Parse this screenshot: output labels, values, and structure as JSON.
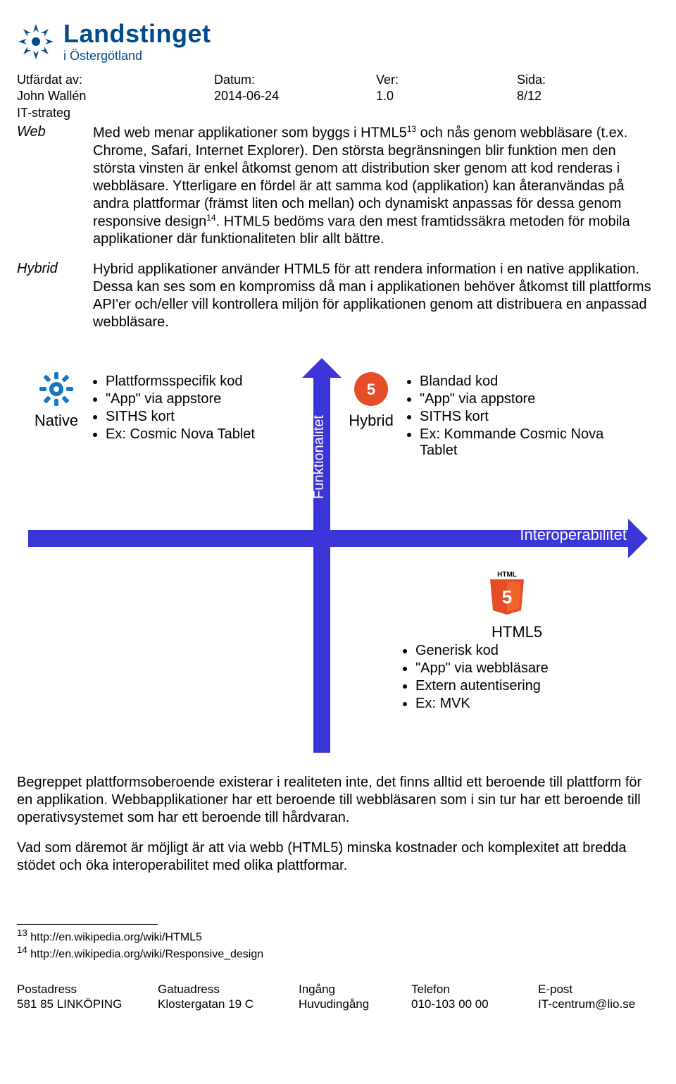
{
  "brand": {
    "line1": "Landstinget",
    "line2": "i Östergötland"
  },
  "meta": {
    "issued_by_label": "Utfärdat av:",
    "issued_by_name": "John Wallén",
    "issued_by_role": "IT-strateg",
    "date_label": "Datum:",
    "date_value": "2014-06-24",
    "ver_label": "Ver:",
    "ver_value": "1.0",
    "page_label": "Sida:",
    "page_value": "8/12"
  },
  "sections": {
    "web": {
      "term": "Web",
      "text_a": "Med web menar applikationer som byggs i HTML5",
      "sup_a": "13",
      "text_b": " och nås genom webbläsare (t.ex. Chrome, Safari, Internet Explorer). Den största begränsningen blir funktion men den största vinsten är enkel åtkomst genom att distribution sker genom att kod renderas i webbläsare. Ytterligare en fördel är att samma kod (applikation) kan återanvändas på andra plattformar (främst liten och mellan) och dynamiskt anpassas för dessa genom responsive design",
      "sup_b": "14",
      "text_c": ". HTML5 bedöms vara den mest framtidssäkra metoden för mobila applikationer där funktionaliteten blir allt bättre."
    },
    "hybrid": {
      "term": "Hybrid",
      "text": "Hybrid applikationer använder HTML5 för att rendera information i en native applikation. Dessa kan ses som en kompromiss då man i applikationen behöver åtkomst till plattforms API'er och/eller vill kontrollera miljön för applikationen genom att distribuera en anpassad webbläsare."
    }
  },
  "chart_data": {
    "type": "diagram",
    "axes": {
      "vertical": "Funktionalitet",
      "horizontal": "Interoperabilitet"
    },
    "quadrants": [
      {
        "id": "native",
        "title": "Native",
        "icon": "gear",
        "position": "top-left",
        "items": [
          "Plattformsspecifik kod",
          "\"App\" via appstore",
          "SITHS kort",
          "Ex: Cosmic Nova Tablet"
        ]
      },
      {
        "id": "hybrid",
        "title": "Hybrid",
        "icon": "html5",
        "position": "top-right",
        "items": [
          "Blandad kod",
          "\"App\" via appstore",
          "SITHS kort",
          "Ex: Kommande Cosmic Nova Tablet"
        ]
      },
      {
        "id": "html5",
        "title": "HTML5",
        "icon": "html5-badge",
        "position": "bottom-right",
        "items": [
          "Generisk kod",
          "\"App\" via webbläsare",
          "Extern autentisering",
          "Ex: MVK"
        ]
      }
    ]
  },
  "post": {
    "p1": "Begreppet plattformsoberoende existerar i realiteten inte, det finns alltid ett beroende till plattform för en applikation. Webbapplikationer har ett beroende till webbläsaren som i sin tur har ett beroende till operativsystemet som har ett beroende till hårdvaran.",
    "p2": "Vad som däremot är möjligt är att via webb (HTML5) minska kostnader och komplexitet att bredda stödet och öka interoperabilitet med olika plattformar."
  },
  "footrefs": {
    "r1_sup": "13",
    "r1": "http://en.wikipedia.org/wiki/HTML5",
    "r2_sup": "14",
    "r2": "http://en.wikipedia.org/wiki/Responsive_design"
  },
  "footer": {
    "c1h": "Postadress",
    "c1v": "581 85 LINKÖPING",
    "c2h": "Gatuadress",
    "c2v": "Klostergatan 19 C",
    "c3h": "Ingång",
    "c3v": "Huvudingång",
    "c4h": "Telefon",
    "c4v": "010-103 00 00",
    "c5h": "E-post",
    "c5v": "IT-centrum@lio.se"
  }
}
